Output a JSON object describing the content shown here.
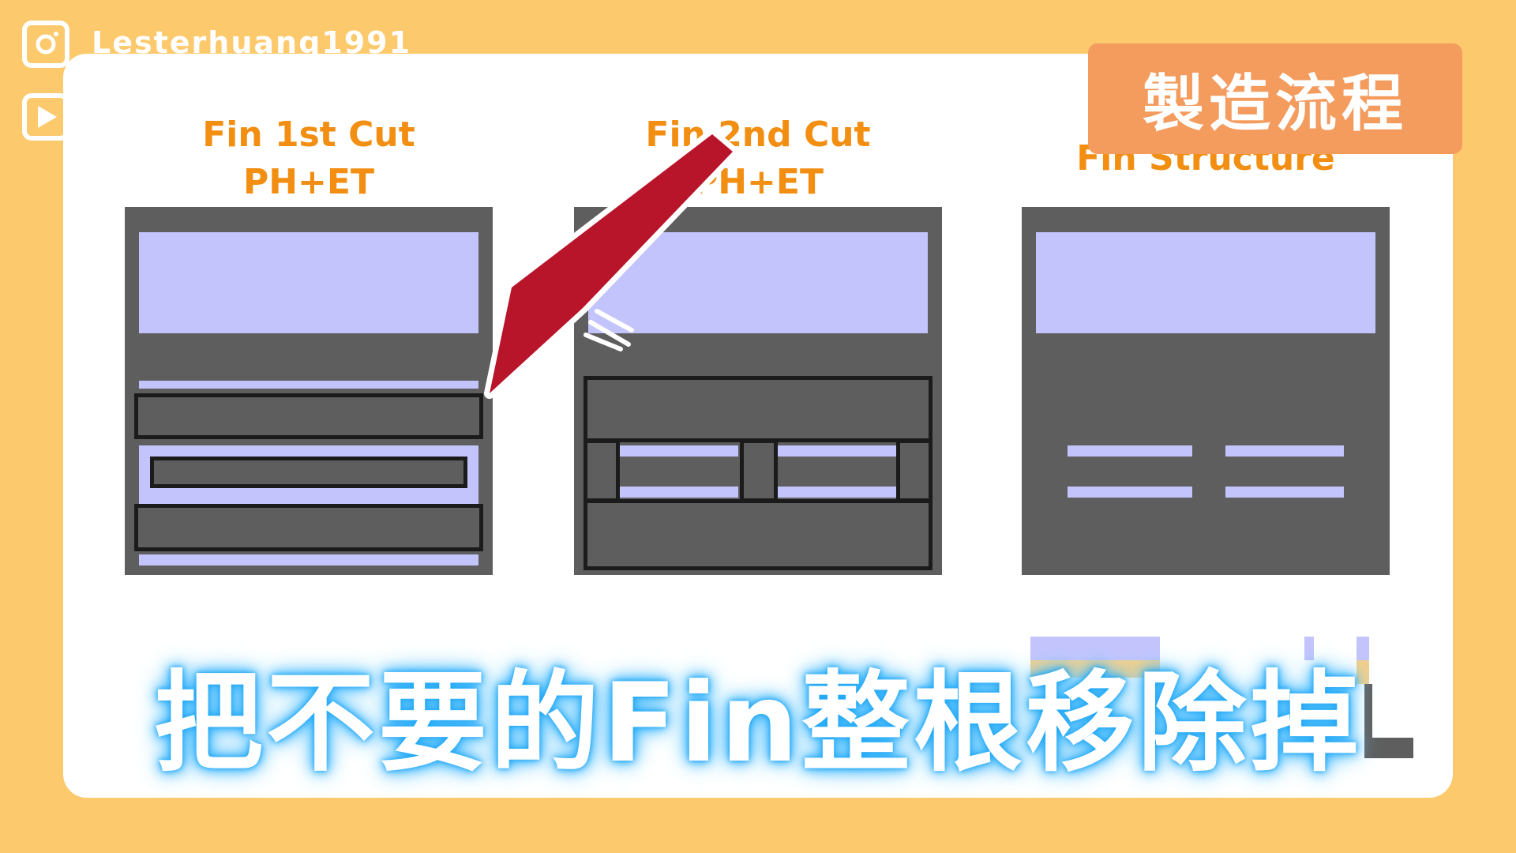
{
  "social": {
    "instagram_handle": "Lesterhuang1991",
    "icons": [
      "instagram-icon",
      "youtube-play-icon"
    ]
  },
  "badge": {
    "label": "製造流程"
  },
  "panels": [
    {
      "title_line1": "Fin 1st Cut",
      "title_line2": "PH+ET"
    },
    {
      "title_line1": "Fin 2nd Cut",
      "title_line2": "PH+ET"
    },
    {
      "title_line1": "Fin Structure"
    }
  ],
  "subtitle": {
    "text": "把不要的Fin整根移除掉"
  },
  "colors": {
    "background": "#fcc96c",
    "card": "#ffffff",
    "badge": "#f49b5e",
    "title": "#f28e12",
    "panel_fill": "#5e5e5e",
    "highlight": "#c4c4fc",
    "arrow": "#b8142a",
    "subtitle_glow": "#1ea6f5"
  }
}
